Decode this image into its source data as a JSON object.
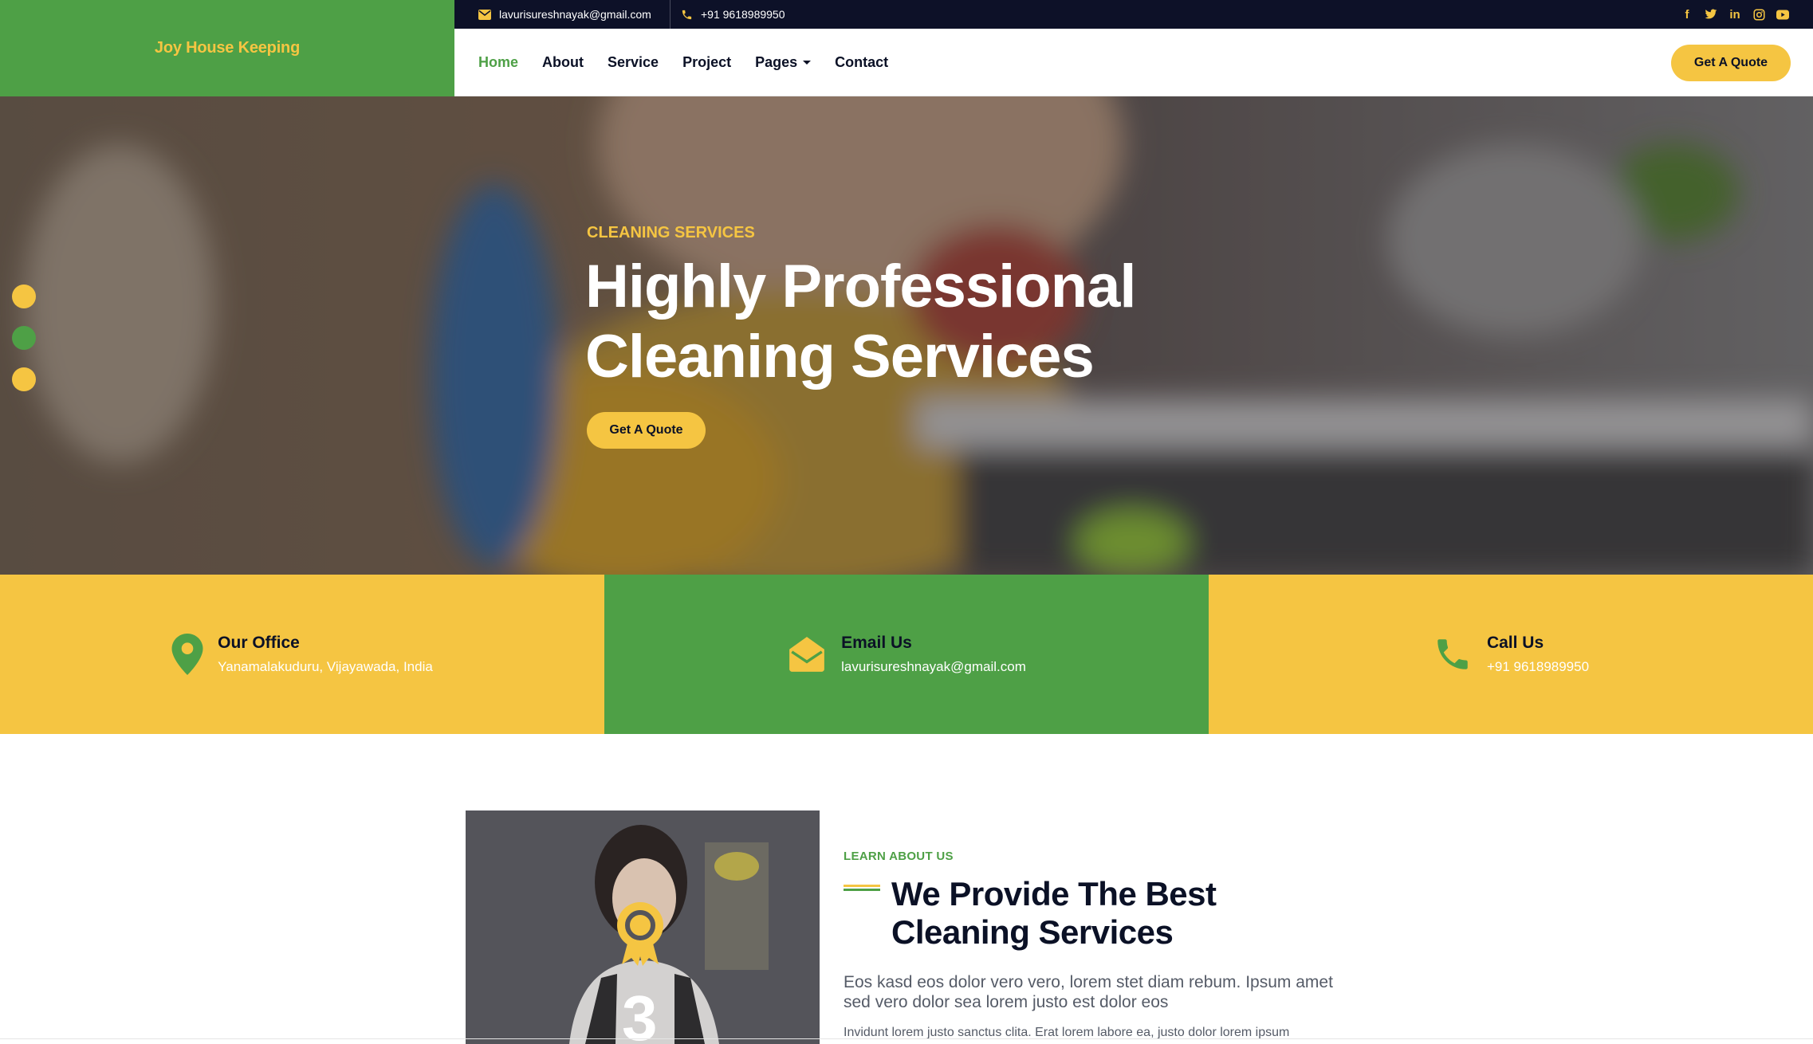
{
  "brand": {
    "name": "Joy House Keeping"
  },
  "topbar": {
    "email": "lavurisureshnayak@gmail.com",
    "phone": "+91 9618989950",
    "socials": [
      "facebook-icon",
      "twitter-icon",
      "linkedin-icon",
      "instagram-icon",
      "youtube-icon"
    ]
  },
  "nav": {
    "items": [
      {
        "label": "Home",
        "active": true
      },
      {
        "label": "About"
      },
      {
        "label": "Service"
      },
      {
        "label": "Project"
      },
      {
        "label": "Pages",
        "dropdown": true
      },
      {
        "label": "Contact"
      }
    ],
    "cta_label": "Get A Quote"
  },
  "hero": {
    "subtitle": "CLEANING SERVICES",
    "title_line1": "Highly Professional",
    "title_line2": "Cleaning Services",
    "cta_label": "Get A Quote",
    "slides": 3
  },
  "contact_cards": [
    {
      "title": "Our Office",
      "value": "Yanamalakuduru, Vijayawada, India",
      "icon": "map-pin-icon",
      "color": "#f5c542"
    },
    {
      "title": "Email Us",
      "value": "lavurisureshnayak@gmail.com",
      "icon": "envelope-open-icon",
      "color": "#4ea046"
    },
    {
      "title": "Call Us",
      "value": "+91 9618989950",
      "icon": "phone-icon",
      "color": "#f5c542"
    }
  ],
  "about": {
    "kicker": "LEARN ABOUT US",
    "title_line1": "We Provide The Best",
    "title_line2": "Cleaning Services",
    "lead": "Eos kasd eos dolor vero vero, lorem stet diam rebum. Ipsum amet sed vero dolor sea lorem justo est dolor eos",
    "body": "Invidunt lorem justo sanctus clita. Erat lorem labore ea, justo dolor lorem ipsum",
    "years": "3"
  },
  "colors": {
    "green": "#4ea046",
    "yellow": "#f5c542",
    "navy": "#0d1128"
  }
}
